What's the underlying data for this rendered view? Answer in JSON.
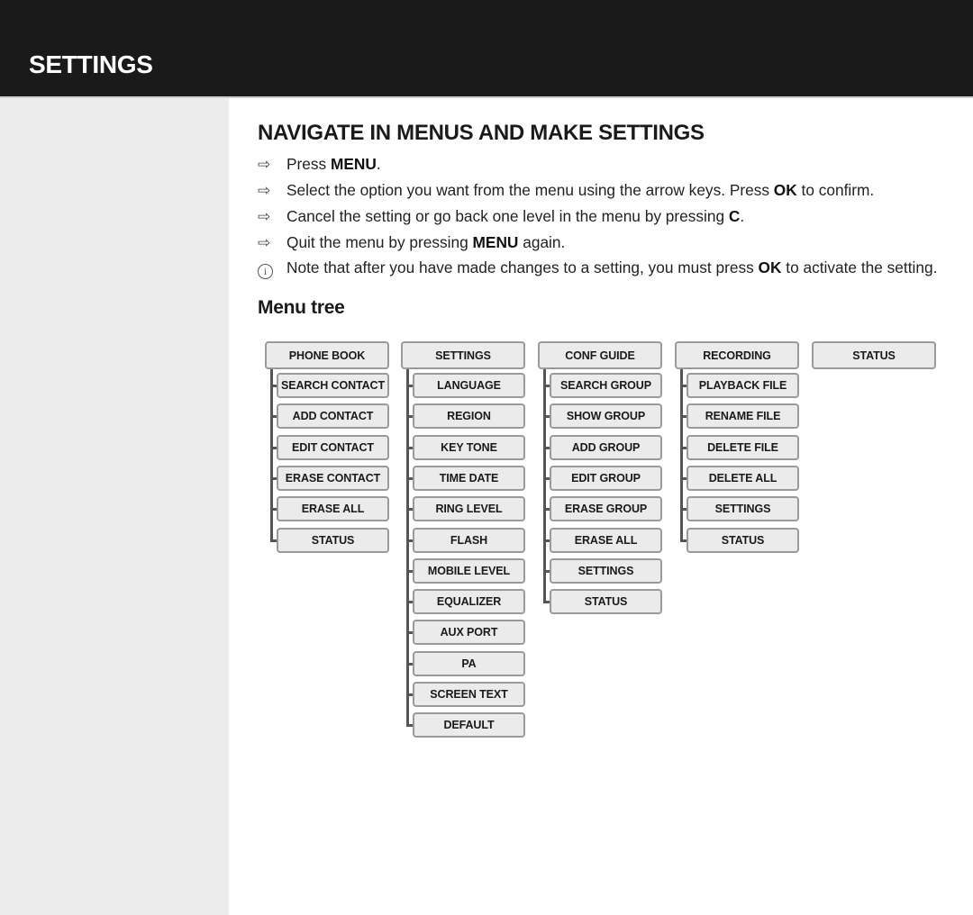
{
  "header": {
    "title": "SETTINGS"
  },
  "main": {
    "title": "NAVIGATE IN MENUS AND MAKE SETTINGS",
    "instructions": [
      {
        "icon": "arrow-right-icon",
        "parts": [
          {
            "t": "Press "
          },
          {
            "b": "MENU"
          },
          {
            "t": "."
          }
        ]
      },
      {
        "icon": "arrow-right-icon",
        "parts": [
          {
            "t": "Select the option you want from the menu using the arrow keys. Press "
          },
          {
            "b": "OK"
          },
          {
            "t": " to confirm."
          }
        ]
      },
      {
        "icon": "arrow-right-icon",
        "parts": [
          {
            "t": "Cancel the setting or go back one level in the menu by pressing "
          },
          {
            "b": "C"
          },
          {
            "t": "."
          }
        ]
      },
      {
        "icon": "arrow-right-icon",
        "parts": [
          {
            "t": "Quit the menu by pressing "
          },
          {
            "b": "MENU"
          },
          {
            "t": " again."
          }
        ]
      },
      {
        "icon": "info-icon",
        "parts": [
          {
            "t": "Note that after you have made changes to a setting, you must press "
          },
          {
            "b": "OK"
          },
          {
            "t": " to activate the setting."
          }
        ]
      }
    ],
    "menu_tree_title": "Menu tree",
    "menu_tree": [
      {
        "label": "PHONE BOOK",
        "children": [
          "SEARCH CONTACT",
          "ADD CONTACT",
          "EDIT CONTACT",
          "ERASE CONTACT",
          "ERASE ALL",
          "STATUS"
        ]
      },
      {
        "label": "SETTINGS",
        "children": [
          "LANGUAGE",
          "REGION",
          "KEY TONE",
          "TIME DATE",
          "RING LEVEL",
          "FLASH",
          "MOBILE LEVEL",
          "EQUALIZER",
          "AUX PORT",
          "PA",
          "SCREEN TEXT",
          "DEFAULT"
        ]
      },
      {
        "label": "CONF GUIDE",
        "children": [
          "SEARCH GROUP",
          "SHOW GROUP",
          "ADD GROUP",
          "EDIT GROUP",
          "ERASE GROUP",
          "ERASE ALL",
          "SETTINGS",
          "STATUS"
        ]
      },
      {
        "label": "RECORDING",
        "children": [
          "PLAYBACK FILE",
          "RENAME FILE",
          "DELETE FILE",
          "DELETE ALL",
          "SETTINGS",
          "STATUS"
        ]
      },
      {
        "label": "STATUS",
        "children": []
      }
    ]
  }
}
